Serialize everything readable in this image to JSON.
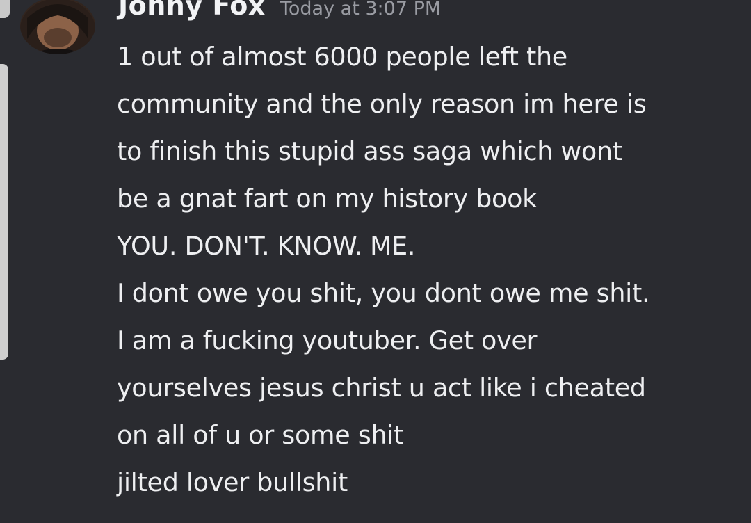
{
  "message_group": {
    "author": {
      "name": "Jonny Fox",
      "avatar_icon": "user-avatar-photo"
    },
    "timestamp": "Today at 3:07 PM",
    "messages": [
      {
        "lines": [
          "1 out of almost 6000 people left the",
          "community and the only reason im here is",
          "to finish this stupid ass saga which wont",
          "be a gnat fart on my history book"
        ]
      },
      {
        "lines": [
          "YOU. DON'T. KNOW. ME."
        ]
      },
      {
        "lines": [
          "I dont owe you shit, you dont owe me shit.",
          "I am a fucking youtuber. Get over",
          "yourselves jesus christ u act like i cheated",
          "on all of u or some shit"
        ]
      },
      {
        "lines": [
          "jilted lover bullshit"
        ]
      }
    ]
  },
  "theme": {
    "background": "#2a2b30",
    "text": "#eeeff1",
    "muted": "#9a9ca3"
  }
}
